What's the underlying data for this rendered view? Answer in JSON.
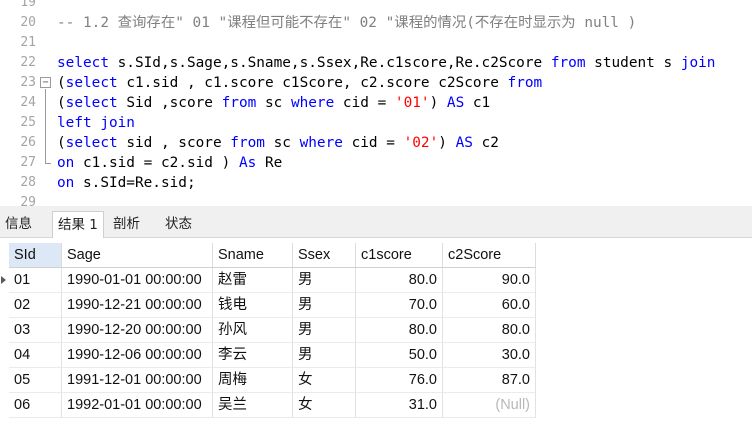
{
  "editor": {
    "fold_symbol": "−",
    "lines": [
      {
        "num": "19",
        "tokens": []
      },
      {
        "num": "20",
        "tokens": [
          {
            "t": "-- 1.2 查询存在\" 01 \"课程但可能不存在\" 02 \"课程的情况(不存在时显示为 null )",
            "c": "cm"
          }
        ]
      },
      {
        "num": "21",
        "tokens": []
      },
      {
        "num": "22",
        "tokens": [
          {
            "t": "select",
            "c": "kw"
          },
          {
            "t": " s.SId,s.Sage,s.Sname,s.Ssex,Re.c1score,Re.c2Score ",
            "c": ""
          },
          {
            "t": "from",
            "c": "kw"
          },
          {
            "t": " student s ",
            "c": ""
          },
          {
            "t": "join",
            "c": "kw"
          }
        ]
      },
      {
        "num": "23",
        "tokens": [
          {
            "t": "(",
            "c": ""
          },
          {
            "t": "select",
            "c": "kw"
          },
          {
            "t": " c1.sid , c1.score c1Score, c2.score c2Score ",
            "c": ""
          },
          {
            "t": "from",
            "c": "kw"
          }
        ]
      },
      {
        "num": "24",
        "tokens": [
          {
            "t": "(",
            "c": ""
          },
          {
            "t": "select",
            "c": "kw"
          },
          {
            "t": " Sid ,score ",
            "c": ""
          },
          {
            "t": "from",
            "c": "kw"
          },
          {
            "t": " sc ",
            "c": ""
          },
          {
            "t": "where",
            "c": "kw"
          },
          {
            "t": " cid = ",
            "c": ""
          },
          {
            "t": "'01'",
            "c": "str"
          },
          {
            "t": ") ",
            "c": ""
          },
          {
            "t": "AS",
            "c": "kw"
          },
          {
            "t": " c1",
            "c": ""
          }
        ]
      },
      {
        "num": "25",
        "tokens": [
          {
            "t": "left join",
            "c": "kw"
          }
        ]
      },
      {
        "num": "26",
        "tokens": [
          {
            "t": "(",
            "c": ""
          },
          {
            "t": "select",
            "c": "kw"
          },
          {
            "t": " sid , score ",
            "c": ""
          },
          {
            "t": "from",
            "c": "kw"
          },
          {
            "t": " sc ",
            "c": ""
          },
          {
            "t": "where",
            "c": "kw"
          },
          {
            "t": " cid = ",
            "c": ""
          },
          {
            "t": "'02'",
            "c": "str"
          },
          {
            "t": ") ",
            "c": ""
          },
          {
            "t": "AS",
            "c": "kw"
          },
          {
            "t": " c2",
            "c": ""
          }
        ]
      },
      {
        "num": "27",
        "tokens": [
          {
            "t": "on",
            "c": "kw"
          },
          {
            "t": " c1.sid = c2.sid ) ",
            "c": ""
          },
          {
            "t": "As",
            "c": "kw"
          },
          {
            "t": " Re",
            "c": ""
          }
        ]
      },
      {
        "num": "28",
        "tokens": [
          {
            "t": "on",
            "c": "kw"
          },
          {
            "t": " s.SId=Re.sid;",
            "c": ""
          }
        ]
      },
      {
        "num": "29",
        "tokens": []
      }
    ]
  },
  "tabs": [
    {
      "label": "信息",
      "active": false
    },
    {
      "label": "结果 1",
      "active": true
    },
    {
      "label": "剖析",
      "active": false
    },
    {
      "label": "状态",
      "active": false
    }
  ],
  "grid": {
    "columns": [
      "SId",
      "Sage",
      "Sname",
      "Ssex",
      "c1score",
      "c2Score"
    ],
    "rows": [
      [
        "01",
        "1990-01-01 00:00:00",
        "赵雷",
        "男",
        "80.0",
        "90.0"
      ],
      [
        "02",
        "1990-12-21 00:00:00",
        "钱电",
        "男",
        "70.0",
        "60.0"
      ],
      [
        "03",
        "1990-12-20 00:00:00",
        "孙风",
        "男",
        "80.0",
        "80.0"
      ],
      [
        "04",
        "1990-12-06 00:00:00",
        "李云",
        "男",
        "50.0",
        "30.0"
      ],
      [
        "05",
        "1991-12-01 00:00:00",
        "周梅",
        "女",
        "76.0",
        "87.0"
      ],
      [
        "06",
        "1992-01-01 00:00:00",
        "吴兰",
        "女",
        "31.0",
        "(Null)"
      ]
    ],
    "current_row": 0
  }
}
